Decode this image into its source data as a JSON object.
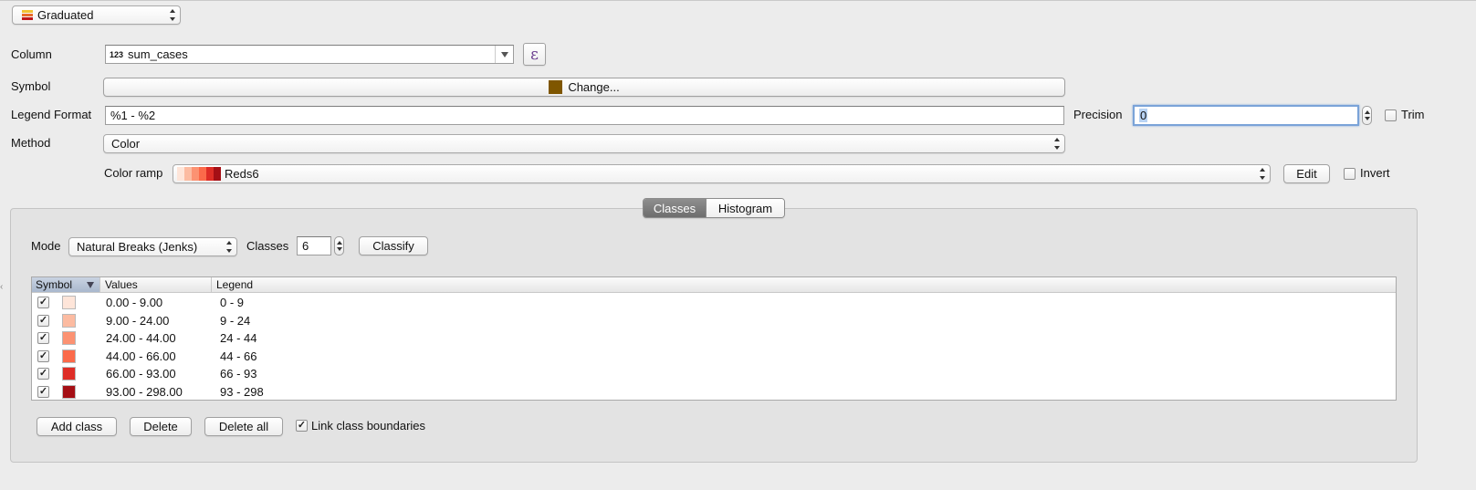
{
  "renderer": {
    "selected": "Graduated",
    "icon": "graduated-renderer-icon"
  },
  "column": {
    "label": "Column",
    "type_badge": "123",
    "value": "sum_cases",
    "expression_button": "ε"
  },
  "symbol": {
    "label": "Symbol",
    "button_label": "Change...",
    "swatch_color": "#7f5600"
  },
  "legend_format": {
    "label": "Legend Format",
    "value": "%1 - %2"
  },
  "precision": {
    "label": "Precision",
    "value": "0",
    "trim_label": "Trim",
    "trim_checked": false
  },
  "method": {
    "label": "Method",
    "value": "Color"
  },
  "color_ramp": {
    "label": "Color ramp",
    "name": "Reds6",
    "colors": [
      "#fee5d9",
      "#fcbba1",
      "#fc9272",
      "#fb6a4a",
      "#de2d26",
      "#a50f15"
    ],
    "edit_label": "Edit",
    "invert_label": "Invert",
    "invert_checked": false
  },
  "tabs": {
    "active": "Classes",
    "items": [
      "Classes",
      "Histogram"
    ]
  },
  "classes_panel": {
    "mode_label": "Mode",
    "mode_value": "Natural Breaks (Jenks)",
    "classes_label": "Classes",
    "classes_value": "6",
    "classify_label": "Classify"
  },
  "table": {
    "headers": {
      "symbol": "Symbol",
      "values": "Values",
      "legend": "Legend"
    },
    "rows": [
      {
        "checked": true,
        "color": "#fee5d9",
        "values": "0.00 - 9.00",
        "legend": "0 - 9"
      },
      {
        "checked": true,
        "color": "#fcbba1",
        "values": "9.00 - 24.00",
        "legend": "9 - 24"
      },
      {
        "checked": true,
        "color": "#fc9272",
        "values": "24.00 - 44.00",
        "legend": "24 - 44"
      },
      {
        "checked": true,
        "color": "#fb6a4a",
        "values": "44.00 - 66.00",
        "legend": "44 - 66"
      },
      {
        "checked": true,
        "color": "#de2d26",
        "values": "66.00 - 93.00",
        "legend": "66 - 93"
      },
      {
        "checked": true,
        "color": "#a50f15",
        "values": "93.00 - 298.00",
        "legend": "93 - 298"
      }
    ]
  },
  "footer": {
    "add_class": "Add class",
    "delete": "Delete",
    "delete_all": "Delete all",
    "link_boundaries_label": "Link class boundaries",
    "link_boundaries_checked": true
  }
}
